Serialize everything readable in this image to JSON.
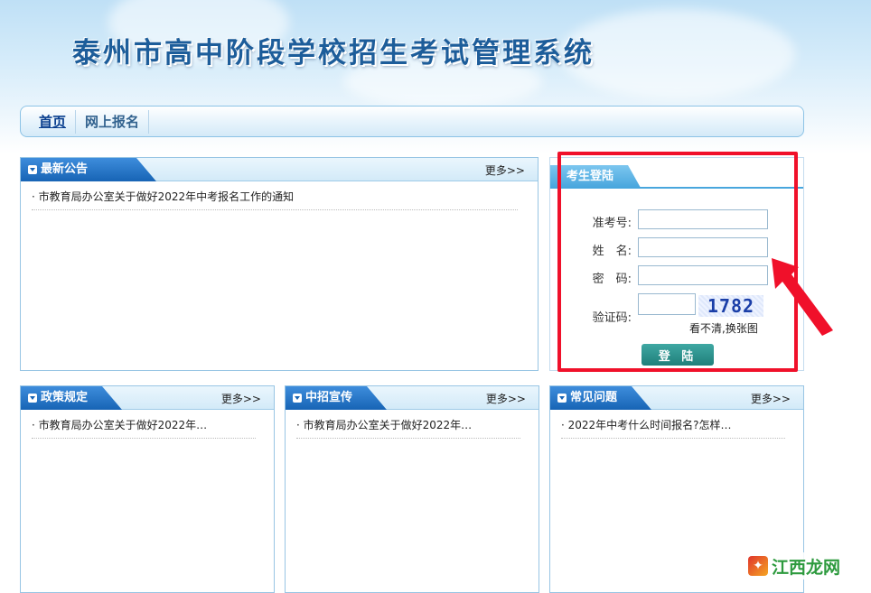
{
  "header": {
    "title": "泰州市高中阶段学校招生考试管理系统"
  },
  "nav": {
    "items": [
      "首页",
      "网上报名"
    ]
  },
  "more_label": "更多>>",
  "announcements": {
    "title": "最新公告",
    "items": [
      "市教育局办公室关于做好2022年中考报名工作的通知"
    ]
  },
  "policy": {
    "title": "政策规定",
    "items": [
      "市教育局办公室关于做好2022年…"
    ]
  },
  "publicity": {
    "title": "中招宣传",
    "items": [
      "市教育局办公室关于做好2022年…"
    ]
  },
  "faq": {
    "title": "常见问题",
    "items": [
      "2022年中考什么时间报名?怎样…"
    ]
  },
  "login": {
    "tab": "考生登陆",
    "exam_no_label": "准考号:",
    "name_label": "姓　名:",
    "password_label": "密　码:",
    "captcha_label": "验证码:",
    "captcha_code": "1782",
    "captcha_refresh": "看不清,换张图",
    "submit": "登 陆"
  },
  "watermark": {
    "text": "江西龙网"
  },
  "colors": {
    "highlight": "#f0102a",
    "tab_blue": "#1764b5",
    "login_btn": "#1f7f7a"
  }
}
